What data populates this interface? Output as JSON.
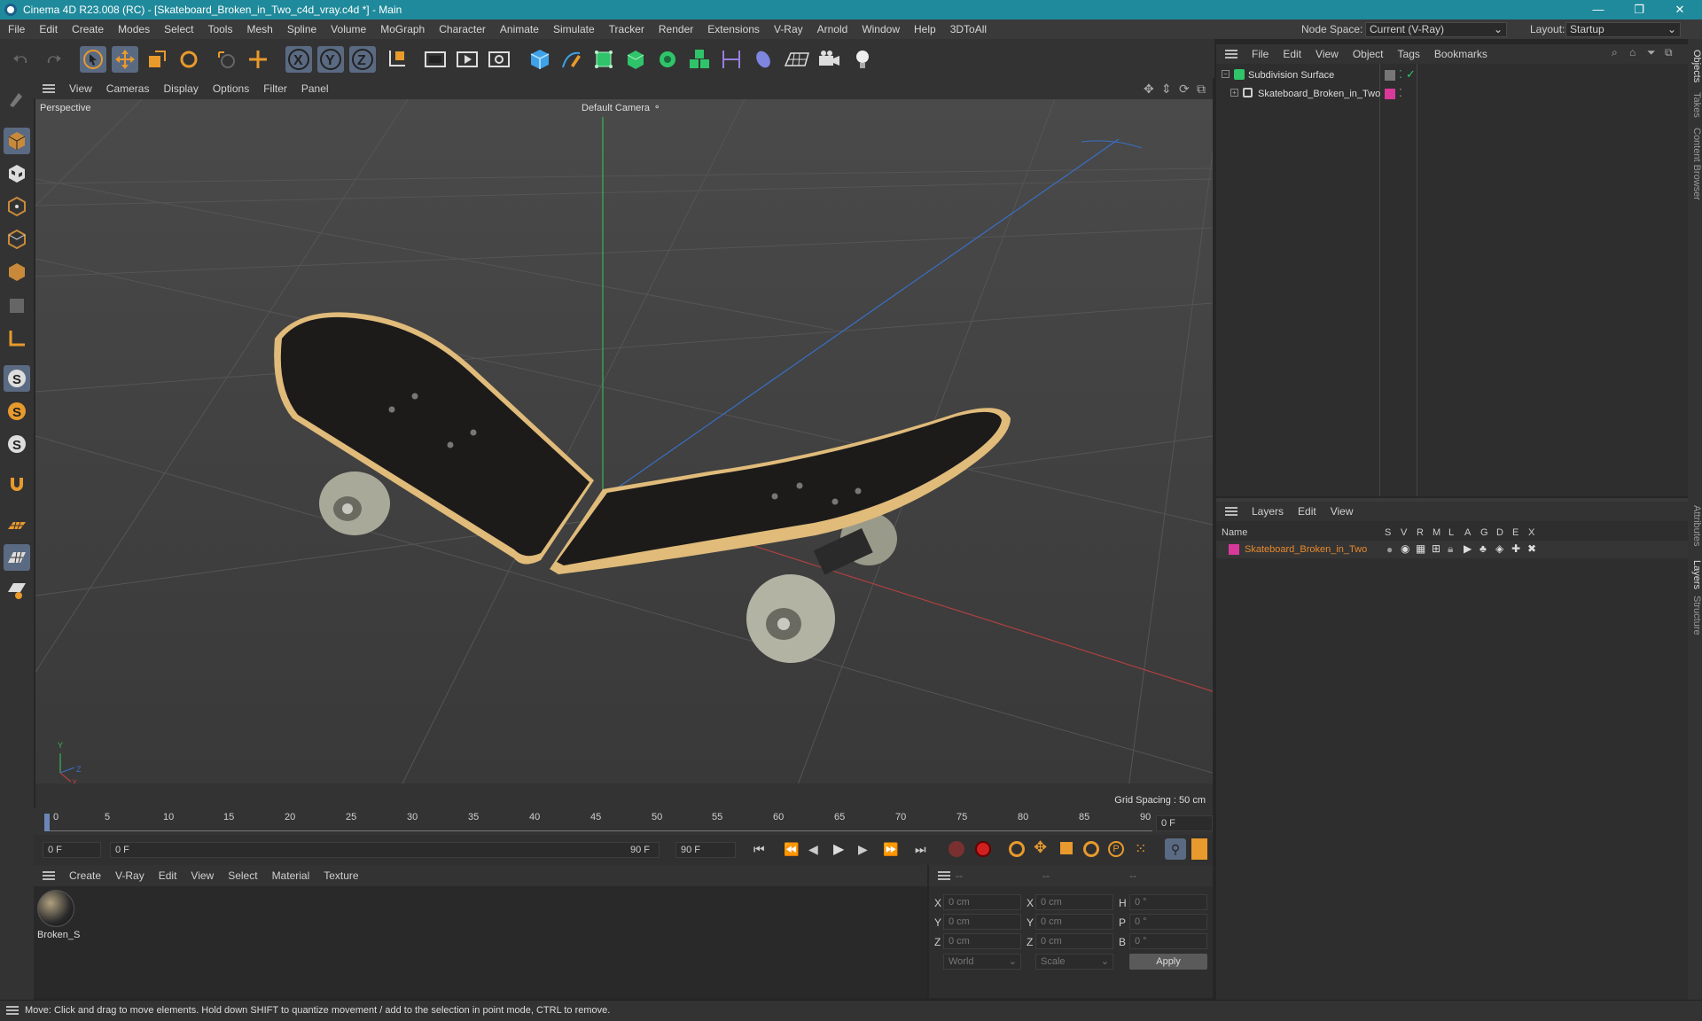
{
  "window": {
    "title": "Cinema 4D R23.008 (RC) - [Skateboard_Broken_in_Two_c4d_vray.c4d *] - Main",
    "minimize": "—",
    "restore": "❐",
    "close": "✕"
  },
  "menu": {
    "items": [
      "File",
      "Edit",
      "Create",
      "Modes",
      "Select",
      "Tools",
      "Mesh",
      "Spline",
      "Volume",
      "MoGraph",
      "Character",
      "Animate",
      "Simulate",
      "Tracker",
      "Render",
      "Extensions",
      "V-Ray",
      "Arnold",
      "Window",
      "Help",
      "3DToAll"
    ],
    "node_space_label": "Node Space:",
    "node_space_value": "Current (V-Ray)",
    "layout_label": "Layout:",
    "layout_value": "Startup"
  },
  "viewport": {
    "menu": [
      "View",
      "Cameras",
      "Display",
      "Options",
      "Filter",
      "Panel"
    ],
    "label": "Perspective",
    "camera": "Default Camera",
    "grid_spacing": "Grid Spacing : 50 cm",
    "axis_x": "X",
    "axis_y": "Y",
    "axis_z": "Z"
  },
  "objects": {
    "menu": [
      "File",
      "Edit",
      "View",
      "Object",
      "Tags",
      "Bookmarks"
    ],
    "items": [
      {
        "name": "Subdivision Surface"
      },
      {
        "name": "Skateboard_Broken_in_Two"
      }
    ]
  },
  "layers": {
    "menu": [
      "Layers",
      "Edit",
      "View"
    ],
    "name_header": "Name",
    "columns": [
      "S",
      "V",
      "R",
      "M",
      "L",
      "A",
      "G",
      "D",
      "E",
      "X"
    ],
    "rows": [
      {
        "name": "Skateboard_Broken_in_Two",
        "color": "#d8399a"
      }
    ]
  },
  "timeline": {
    "ticks": [
      "0",
      "5",
      "10",
      "15",
      "20",
      "25",
      "30",
      "35",
      "40",
      "45",
      "50",
      "55",
      "60",
      "65",
      "70",
      "75",
      "80",
      "85",
      "90"
    ],
    "current_frame": "0 F",
    "start_frame": "0 F",
    "range_start": "0 F",
    "range_end": "90 F",
    "end_frame": "90 F",
    "frame_right": "0 F"
  },
  "materials": {
    "menu": [
      "Create",
      "V-Ray",
      "Edit",
      "View",
      "Select",
      "Material",
      "Texture"
    ],
    "items": [
      {
        "name": "Broken_S"
      }
    ]
  },
  "coords": {
    "headers": [
      "--",
      "--",
      "--"
    ],
    "rows": [
      {
        "a_label": "X",
        "a_val": "0 cm",
        "b_label": "X",
        "b_val": "0 cm",
        "c_label": "H",
        "c_val": "0 °"
      },
      {
        "a_label": "Y",
        "a_val": "0 cm",
        "b_label": "Y",
        "b_val": "0 cm",
        "c_label": "P",
        "c_val": "0 °"
      },
      {
        "a_label": "Z",
        "a_val": "0 cm",
        "b_label": "Z",
        "b_val": "0 cm",
        "c_label": "B",
        "c_val": "0 °"
      }
    ],
    "world": "World",
    "scale": "Scale",
    "apply": "Apply"
  },
  "side_tabs": [
    "Objects",
    "Takes",
    "Content Browser",
    "Attributes",
    "Layers",
    "Structure"
  ],
  "status": "Move: Click and drag to move elements. Hold down SHIFT to quantize movement / add to the selection in point mode, CTRL to remove."
}
